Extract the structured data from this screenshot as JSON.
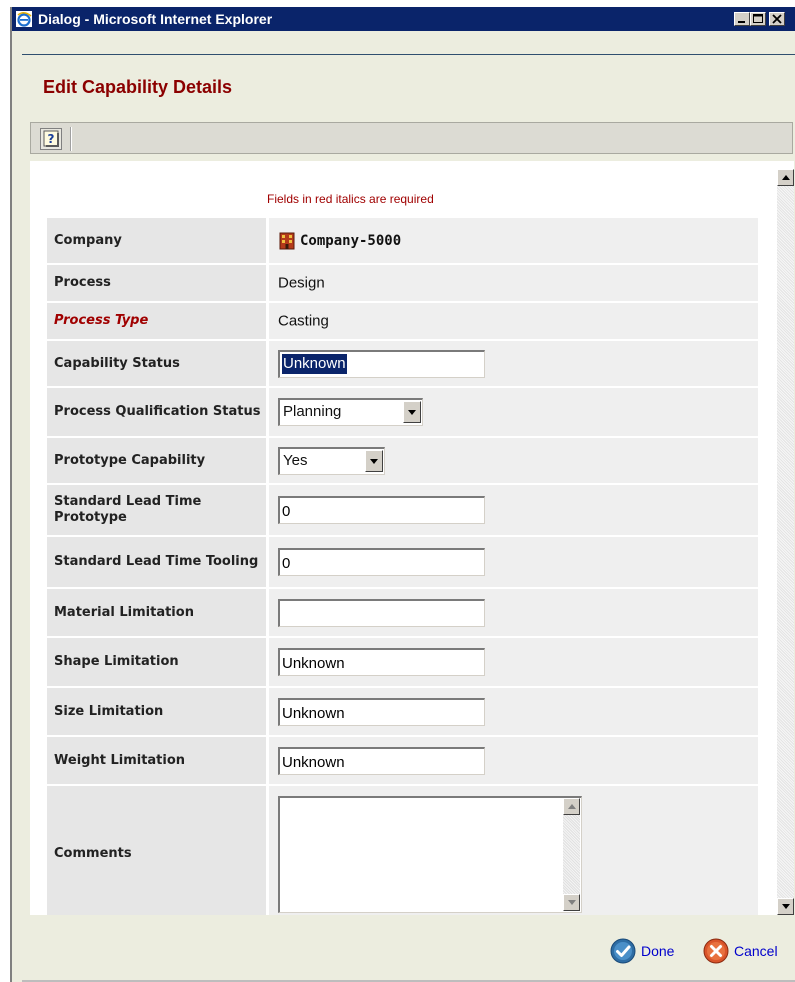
{
  "window": {
    "title": "Dialog - Microsoft Internet Explorer"
  },
  "dialog": {
    "title": "Edit Capability Details",
    "required_note": "Fields in red italics are required"
  },
  "fields": {
    "company": {
      "label": "Company",
      "value": "Company-5000"
    },
    "process": {
      "label": "Process",
      "value": "Design"
    },
    "process_type": {
      "label": "Process Type",
      "value": "Casting",
      "required": true
    },
    "capability_status": {
      "label": "Capability Status",
      "value": "Unknown",
      "selected": true
    },
    "process_qualification_status": {
      "label": "Process Qualification Status",
      "value": "Planning"
    },
    "prototype_capability": {
      "label": "Prototype Capability",
      "value": "Yes"
    },
    "std_lead_time_prototype": {
      "label": "Standard Lead Time Prototype",
      "value": "0"
    },
    "std_lead_time_tooling": {
      "label": "Standard Lead Time Tooling",
      "value": "0"
    },
    "material_limitation": {
      "label": "Material Limitation",
      "value": ""
    },
    "shape_limitation": {
      "label": "Shape Limitation",
      "value": "Unknown"
    },
    "size_limitation": {
      "label": "Size Limitation",
      "value": "Unknown"
    },
    "weight_limitation": {
      "label": "Weight Limitation",
      "value": "Unknown"
    },
    "comments": {
      "label": "Comments",
      "value": ""
    }
  },
  "footer": {
    "done_label": "Done",
    "cancel_label": "Cancel"
  },
  "colors": {
    "titlebar": "#0a246a",
    "dialog_title": "#8b0000",
    "required": "#a00000",
    "link": "#0000cc",
    "done_icon": "#2e6da4",
    "cancel_icon": "#d9542a"
  },
  "icons": {
    "titlebar": "ie-icon",
    "help": "help-icon",
    "company": "building-icon",
    "done": "checkmark-icon",
    "cancel": "x-icon"
  }
}
